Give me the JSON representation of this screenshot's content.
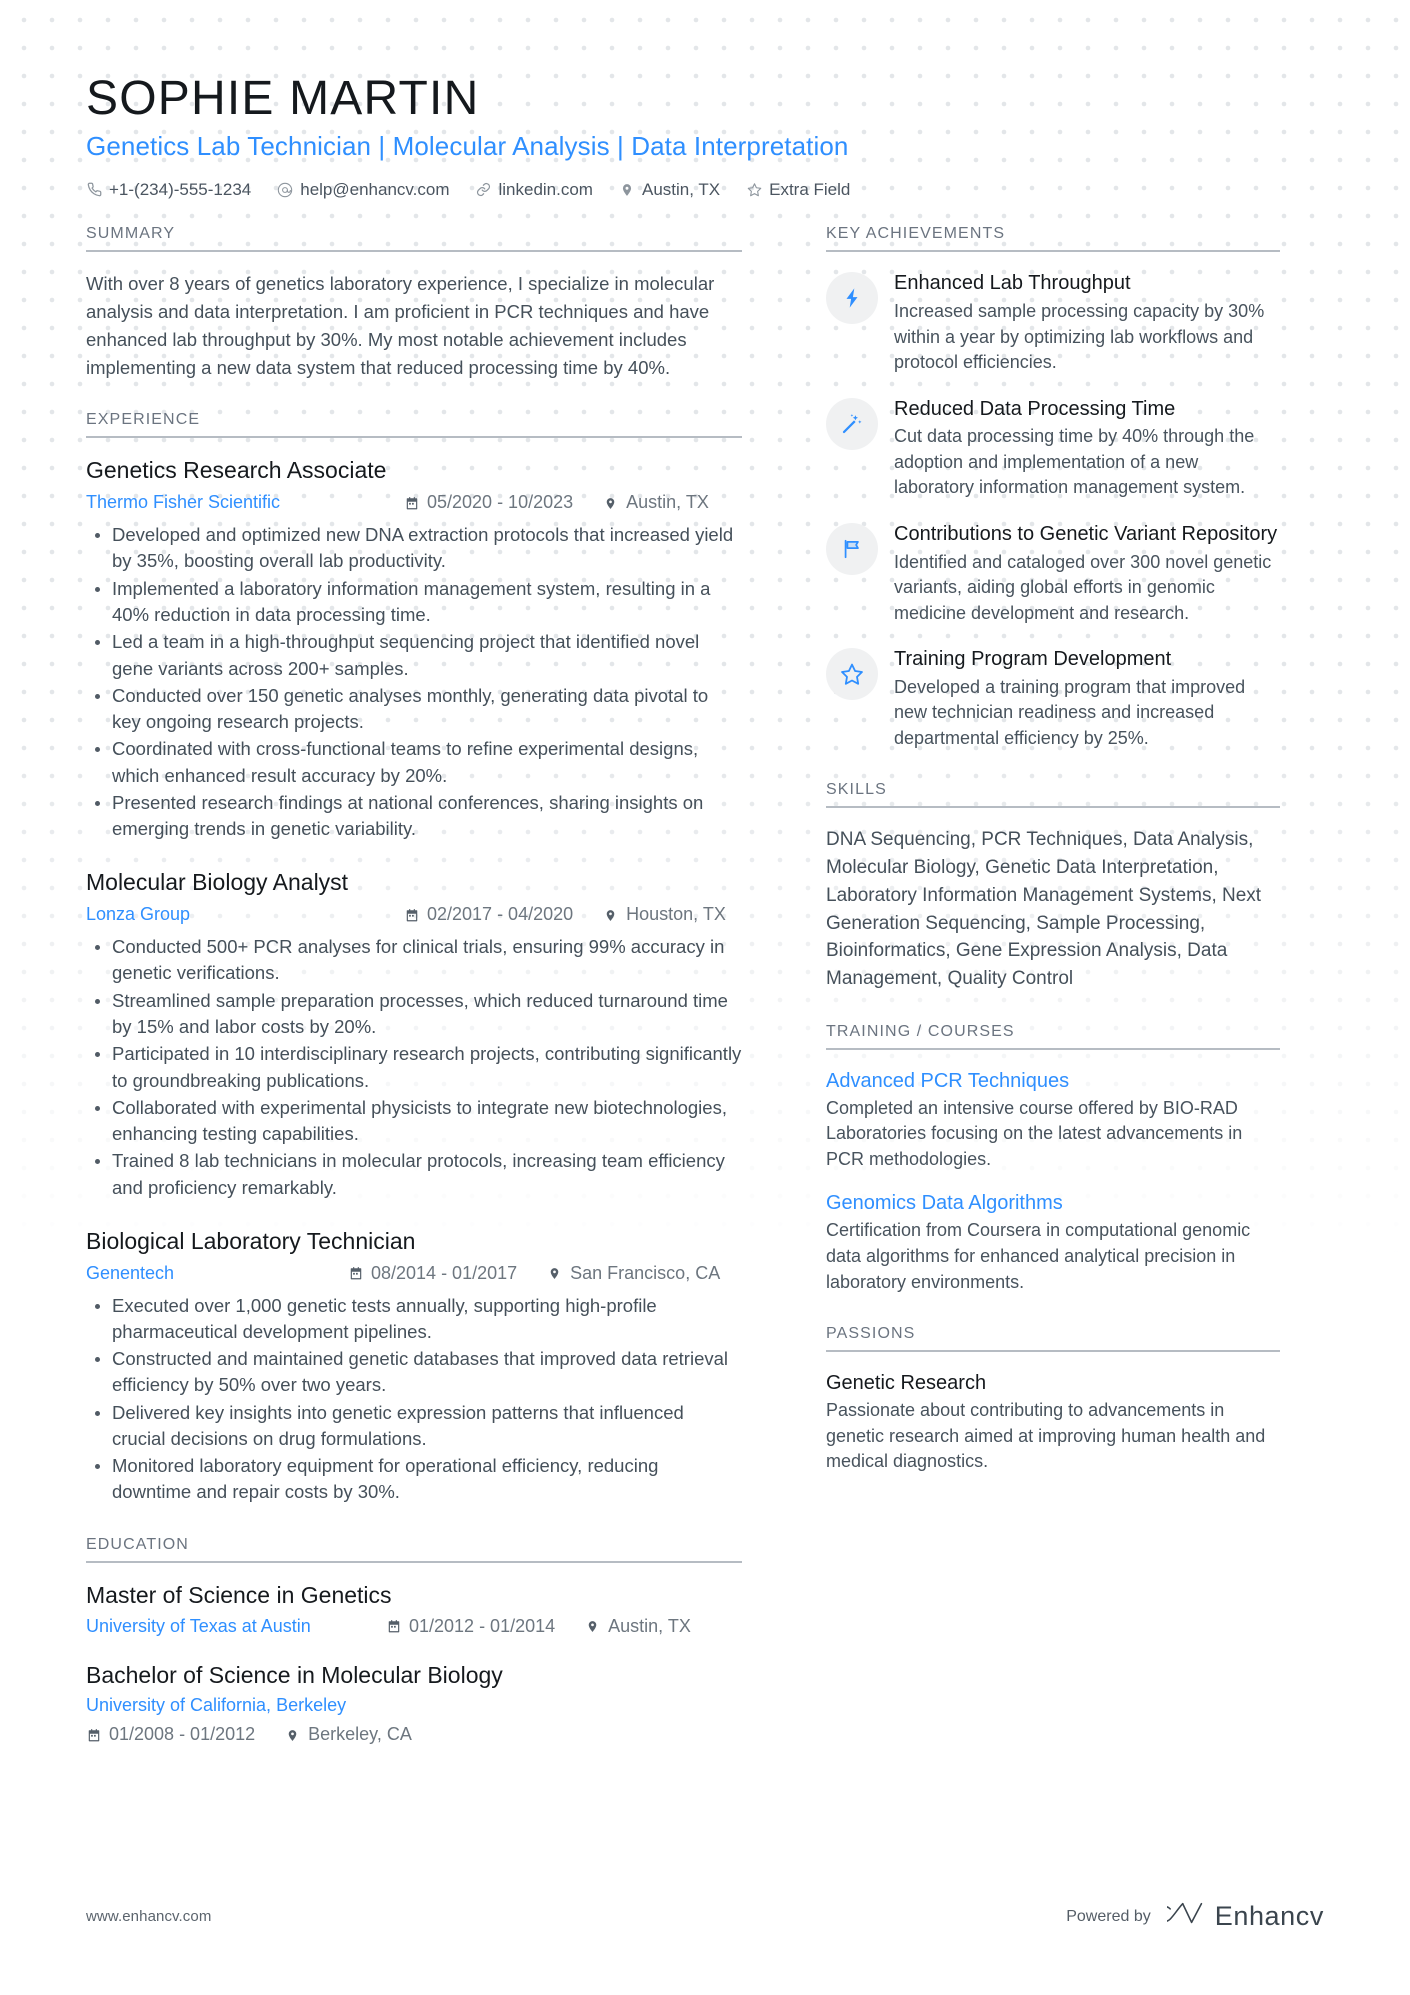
{
  "theme": {
    "accent": "#2f8fff",
    "heading": "#15191d",
    "body": "#45505a",
    "section_label": "#6b7480",
    "icon_bg": "#f0f1f2"
  },
  "header": {
    "name": "SOPHIE MARTIN",
    "headline": "Genetics Lab Technician | Molecular Analysis | Data Interpretation",
    "contacts": [
      {
        "icon": "phone-icon",
        "text": "+1-(234)-555-1234"
      },
      {
        "icon": "email-icon",
        "text": "help@enhancv.com"
      },
      {
        "icon": "link-icon",
        "text": "linkedin.com"
      },
      {
        "icon": "location-pin-icon",
        "text": "Austin, TX"
      },
      {
        "icon": "star-icon",
        "text": "Extra Field"
      }
    ]
  },
  "summary": {
    "label": "SUMMARY",
    "text": "With over 8 years of genetics laboratory experience, I specialize in molecular analysis and data interpretation. I am proficient in PCR techniques and have enhanced lab throughput by 30%. My most notable achievement includes implementing a new data system that reduced processing time by 40%."
  },
  "experience": {
    "label": "EXPERIENCE",
    "jobs": [
      {
        "title": "Genetics Research Associate",
        "company": "Thermo Fisher Scientific",
        "dates": "05/2020 - 10/2023",
        "location": "Austin, TX",
        "bullets": [
          "Developed and optimized new DNA extraction protocols that increased yield by 35%, boosting overall lab productivity.",
          "Implemented a laboratory information management system, resulting in a 40% reduction in data processing time.",
          "Led a team in a high-throughput sequencing project that identified novel gene variants across 200+ samples.",
          "Conducted over 150 genetic analyses monthly, generating data pivotal to key ongoing research projects.",
          "Coordinated with cross-functional teams to refine experimental designs, which enhanced result accuracy by 20%.",
          "Presented research findings at national conferences, sharing insights on emerging trends in genetic variability."
        ]
      },
      {
        "title": "Molecular Biology Analyst",
        "company": "Lonza Group",
        "dates": "02/2017 - 04/2020",
        "location": "Houston, TX",
        "bullets": [
          "Conducted 500+ PCR analyses for clinical trials, ensuring 99% accuracy in genetic verifications.",
          "Streamlined sample preparation processes, which reduced turnaround time by 15% and labor costs by 20%.",
          "Participated in 10 interdisciplinary research projects, contributing significantly to groundbreaking publications.",
          "Collaborated with experimental physicists to integrate new biotechnologies, enhancing testing capabilities.",
          "Trained 8 lab technicians in molecular protocols, increasing team efficiency and proficiency remarkably."
        ]
      },
      {
        "title": "Biological Laboratory Technician",
        "company": "Genentech",
        "dates": "08/2014 - 01/2017",
        "location": "San Francisco, CA",
        "bullets": [
          "Executed over 1,000 genetic tests annually, supporting high-profile pharmaceutical development pipelines.",
          "Constructed and maintained genetic databases that improved data retrieval efficiency by 50% over two years.",
          "Delivered key insights into genetic expression patterns that influenced crucial decisions on drug formulations.",
          "Monitored laboratory equipment for operational efficiency, reducing downtime and repair costs by 30%."
        ]
      }
    ]
  },
  "education": {
    "label": "EDUCATION",
    "entries": [
      {
        "degree": "Master of Science in Genetics",
        "school": "University of Texas at Austin",
        "dates": "01/2012 - 01/2014",
        "location": "Austin, TX",
        "stacked": false
      },
      {
        "degree": "Bachelor of Science in Molecular Biology",
        "school": "University of California, Berkeley",
        "dates": "01/2008 - 01/2012",
        "location": "Berkeley, CA",
        "stacked": true
      }
    ]
  },
  "key_achievements": {
    "label": "KEY ACHIEVEMENTS",
    "items": [
      {
        "icon": "lightning-bolt-icon",
        "title": "Enhanced Lab Throughput",
        "desc": "Increased sample processing capacity by 30% within a year by optimizing lab workflows and protocol efficiencies."
      },
      {
        "icon": "magic-wand-icon",
        "title": "Reduced Data Processing Time",
        "desc": "Cut data processing time by 40% through the adoption and implementation of a new laboratory information management system."
      },
      {
        "icon": "flag-icon",
        "title": "Contributions to Genetic Variant Repository",
        "desc": "Identified and cataloged over 300 novel genetic variants, aiding global efforts in genomic medicine development and research."
      },
      {
        "icon": "star-outline-icon",
        "title": "Training Program Development",
        "desc": "Developed a training program that improved new technician readiness and increased departmental efficiency by 25%."
      }
    ]
  },
  "skills": {
    "label": "SKILLS",
    "text": "DNA Sequencing, PCR Techniques, Data Analysis, Molecular Biology, Genetic Data Interpretation, Laboratory Information Management Systems, Next Generation Sequencing, Sample Processing, Bioinformatics, Gene Expression Analysis, Data Management, Quality Control"
  },
  "training": {
    "label": "TRAINING / COURSES",
    "courses": [
      {
        "title": "Advanced PCR Techniques",
        "desc": "Completed an intensive course offered by BIO-RAD Laboratories focusing on the latest advancements in PCR methodologies."
      },
      {
        "title": "Genomics Data Algorithms",
        "desc": "Certification from Coursera in computational genomic data algorithms for enhanced analytical precision in laboratory environments."
      }
    ]
  },
  "passions": {
    "label": "PASSIONS",
    "items": [
      {
        "title": "Genetic Research",
        "desc": "Passionate about contributing to advancements in genetic research aimed at improving human health and medical diagnostics."
      }
    ]
  },
  "footer": {
    "url": "www.enhancv.com",
    "powered_by": "Powered by",
    "brand": "Enhancv"
  }
}
